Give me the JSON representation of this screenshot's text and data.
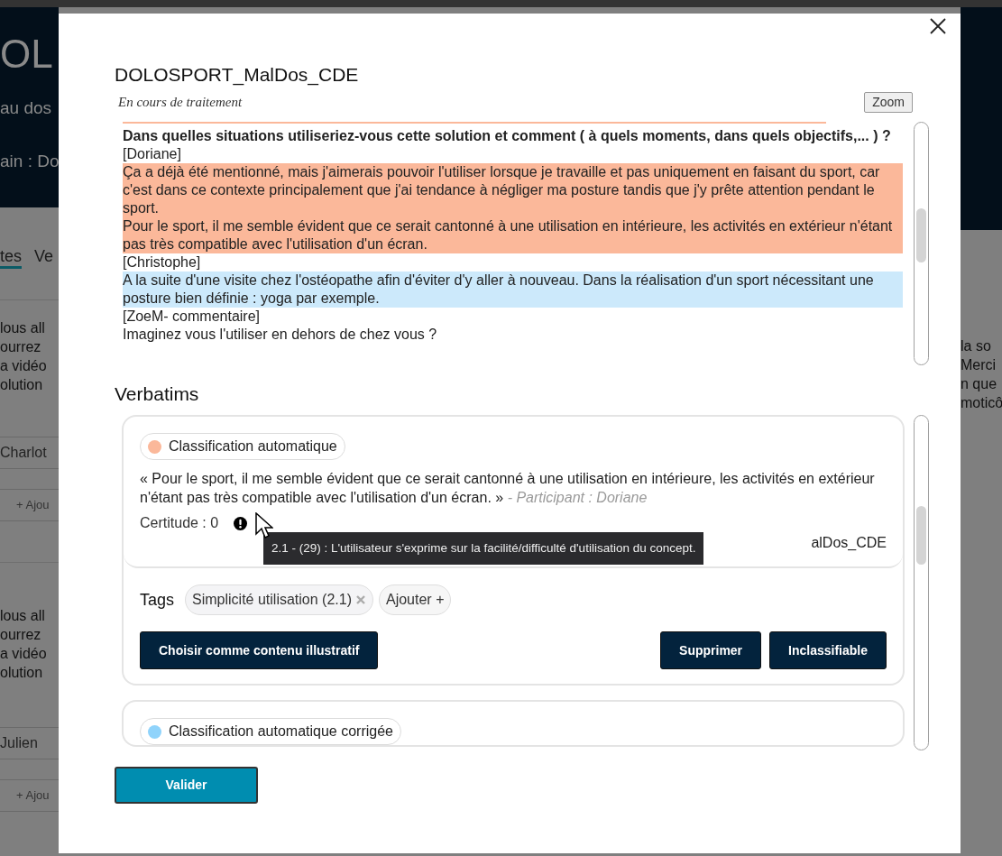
{
  "background": {
    "left": {
      "logo": "OL",
      "header_lines": [
        "au dos",
        "ain : Do"
      ],
      "tabs": [
        {
          "label": "tes",
          "selected": true
        },
        {
          "label": "Ve",
          "selected": false
        }
      ],
      "groups": [
        {
          "lines": [
            "lous  all",
            "ourrez",
            "a vidéo",
            "olution"
          ],
          "chip": "Charlot",
          "add_button": "+ Ajou"
        },
        {
          "lines": [
            "lous  all",
            "ourrez",
            "a vidéo",
            "olution"
          ],
          "chip": "Julien",
          "add_button": "+ Ajou"
        }
      ]
    },
    "right": {
      "lines": [
        "la  so",
        "Merci",
        "n que",
        "moticô"
      ]
    }
  },
  "modal": {
    "title": "DOLOSPORT_MalDos_CDE",
    "status": "En cours de traitement",
    "zoom_button": "Zoom",
    "transcript": [
      {
        "kind": "question",
        "text": "Dans quelles situations utiliseriez-vous cette solution et comment ( à quels moments, dans quels objectifs,... ) ?"
      },
      {
        "kind": "speaker",
        "text": "[Doriane]"
      },
      {
        "kind": "quote",
        "color": "#fbb89a",
        "text": "Ça a déjà été mentionné, mais j'aimerais pouvoir l'utiliser lorsque je travaille et pas uniquement en faisant du sport, car c'est dans ce contexte principalement que j'ai tendance à négliger ma posture tandis que j'y prête attention pendant le sport."
      },
      {
        "kind": "quote",
        "color": "#fbb89a",
        "text": "Pour le sport, il me semble évident que ce serait cantonné à une utilisation en intérieure, les activités en extérieur n'étant pas très compatible avec l'utilisation d'un écran."
      },
      {
        "kind": "speaker",
        "text": "[Christophe]"
      },
      {
        "kind": "quote",
        "color": "#cce9fb",
        "text": "A la suite d'une visite chez l'ostéopathe afin d'éviter d'y aller à nouveau. Dans la réalisation d'un sport nécessitant une posture bien définie : yoga par exemple."
      },
      {
        "kind": "speaker",
        "text": "[ZoeM- commentaire]"
      },
      {
        "kind": "plain",
        "text": "Imaginez vous l'utiliser en dehors de chez vous ?"
      }
    ],
    "verbatims_heading": "Verbatims",
    "verbatims": [
      {
        "badge": "Classification automatique",
        "color": "#fbb89a",
        "quote": "« Pour le sport, il me semble évident que ce serait cantonné à une utilisation en intérieure, les activités en extérieur n'étant pas très compatible avec l'utilisation d'un écran. »",
        "participant": "- Participant : Doriane",
        "certainty": "Certitude : 0",
        "source": "alDos_CDE",
        "tooltip": "2.1 - (29) : L'utilisateur s'exprime sur la facilité/difficulté d'utilisation du concept.",
        "tags_label": "Tags",
        "tags": [
          "Simplicité utilisation (2.1)"
        ],
        "add_tag": "Ajouter +",
        "illustrate_button": "Choisir comme contenu illustratif",
        "delete_button": "Supprimer",
        "unclassifiable_button": "Inclassifiable"
      },
      {
        "badge": "Classification automatique corrigée",
        "color": "#8fd3fb"
      }
    ],
    "validate_button": "Valider"
  }
}
